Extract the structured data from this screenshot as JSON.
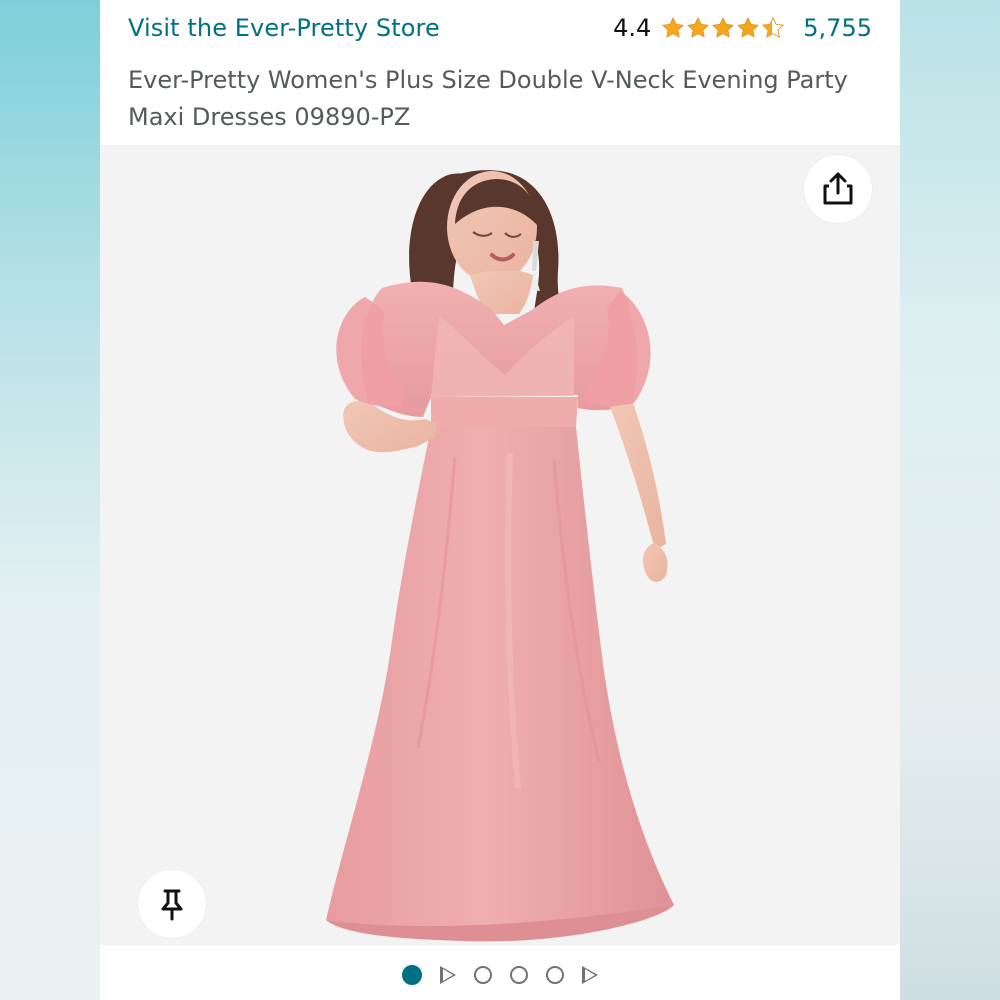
{
  "store": {
    "link_label": "Visit the Ever-Pretty Store"
  },
  "rating": {
    "value": "4.4",
    "stars": 4.4,
    "review_count": "5,755"
  },
  "product": {
    "title": "Ever-Pretty Women's Plus Size Double V-Neck Evening Party Maxi Dresses 09890-PZ"
  },
  "controls": {
    "share_icon": "share-icon",
    "pin_icon": "pin-icon"
  },
  "carousel": {
    "items": [
      {
        "type": "image",
        "active": true
      },
      {
        "type": "video",
        "active": false
      },
      {
        "type": "image",
        "active": false
      },
      {
        "type": "image",
        "active": false
      },
      {
        "type": "image",
        "active": false
      },
      {
        "type": "video",
        "active": false
      }
    ]
  },
  "colors": {
    "link": "#007185",
    "star": "#F7A51B",
    "dress": "#E9A1A2",
    "background": "#F3F3F3"
  }
}
